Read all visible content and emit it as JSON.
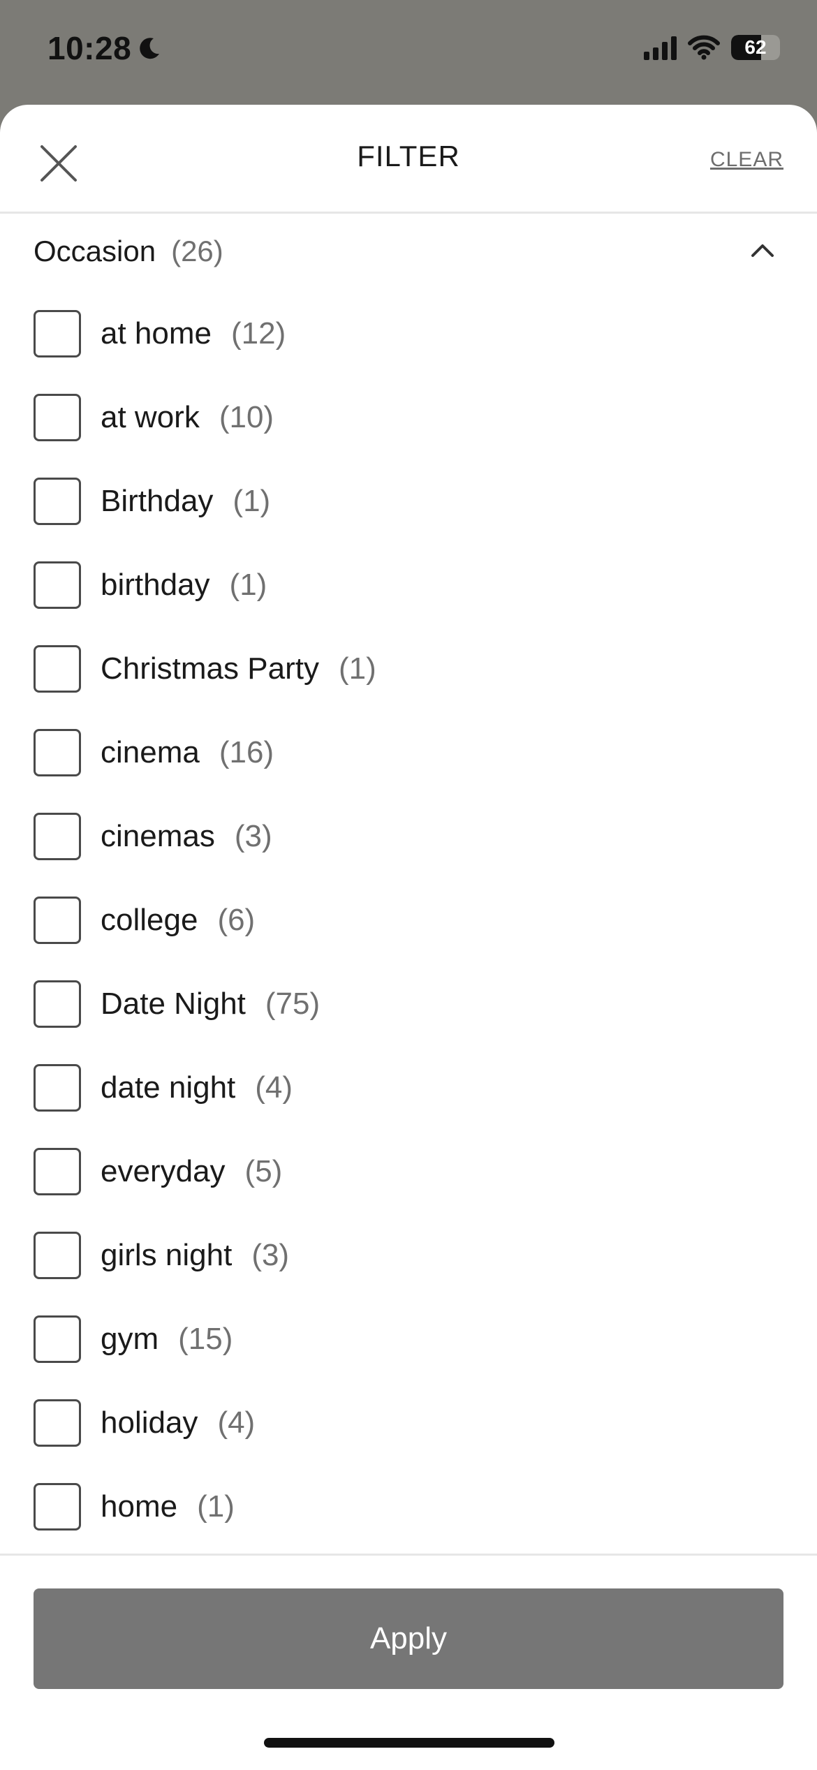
{
  "status_bar": {
    "time": "10:28",
    "battery": "62",
    "battery_level": 0.62
  },
  "sheet": {
    "title": "FILTER",
    "clear_label": "CLEAR",
    "section": {
      "title": "Occasion",
      "count": "(26)"
    },
    "options": [
      {
        "label": "at home",
        "count": "(12)"
      },
      {
        "label": "at work",
        "count": "(10)"
      },
      {
        "label": "Birthday",
        "count": "(1)"
      },
      {
        "label": "birthday",
        "count": "(1)"
      },
      {
        "label": "Christmas Party",
        "count": "(1)"
      },
      {
        "label": "cinema",
        "count": "(16)"
      },
      {
        "label": "cinemas",
        "count": "(3)"
      },
      {
        "label": "college",
        "count": "(6)"
      },
      {
        "label": "Date Night",
        "count": "(75)"
      },
      {
        "label": "date night",
        "count": "(4)"
      },
      {
        "label": "everyday",
        "count": "(5)"
      },
      {
        "label": "girls night",
        "count": "(3)"
      },
      {
        "label": "gym",
        "count": "(15)"
      },
      {
        "label": "holiday",
        "count": "(4)"
      },
      {
        "label": "home",
        "count": "(1)"
      }
    ],
    "apply_label": "Apply"
  },
  "colors": {
    "backdrop": "#7c7b76",
    "apply_button": "#767676",
    "count_text": "#707070"
  },
  "icons": {
    "close": "close-icon",
    "collapse": "chevron-up-icon",
    "dnd": "moon-icon",
    "signal": "cellular-signal-icon",
    "wifi": "wifi-icon",
    "battery": "battery-icon"
  }
}
